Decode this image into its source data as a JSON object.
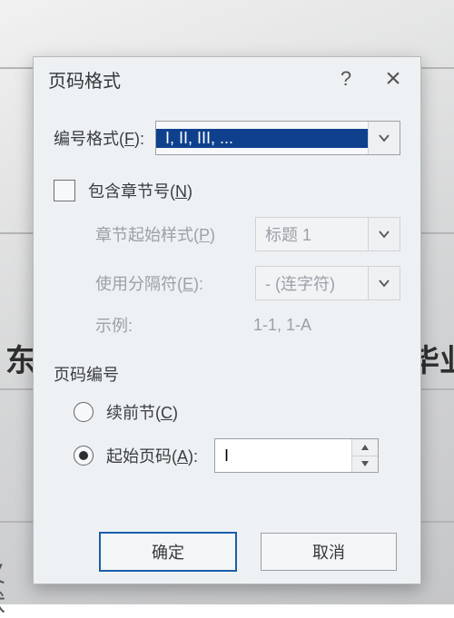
{
  "background": {
    "textLeft": "东",
    "textRight": "毕业论"
  },
  "dialog": {
    "title": "页码格式",
    "help": "?",
    "close": "×",
    "numberFormat": {
      "label": "编号格式(<u>F</u>):",
      "value": "I, II, III, ..."
    },
    "includeChapter": {
      "label": "包含章节号(<u>N</u>)",
      "checked": false
    },
    "chapterStart": {
      "label": "章节起始样式(<u>P</u>)",
      "value": "标题 1"
    },
    "separator": {
      "label": "使用分隔符(<u>E</u>):",
      "value": "-  (连字符)"
    },
    "example": {
      "label": "示例:",
      "value": "1-1, 1-A"
    },
    "section": "页码编号",
    "continue": {
      "label": "续前节(<u>C</u>)"
    },
    "startAt": {
      "label": "起始页码(<u>A</u>):",
      "value": "I"
    },
    "ok": "确定",
    "cancel": "取消"
  }
}
